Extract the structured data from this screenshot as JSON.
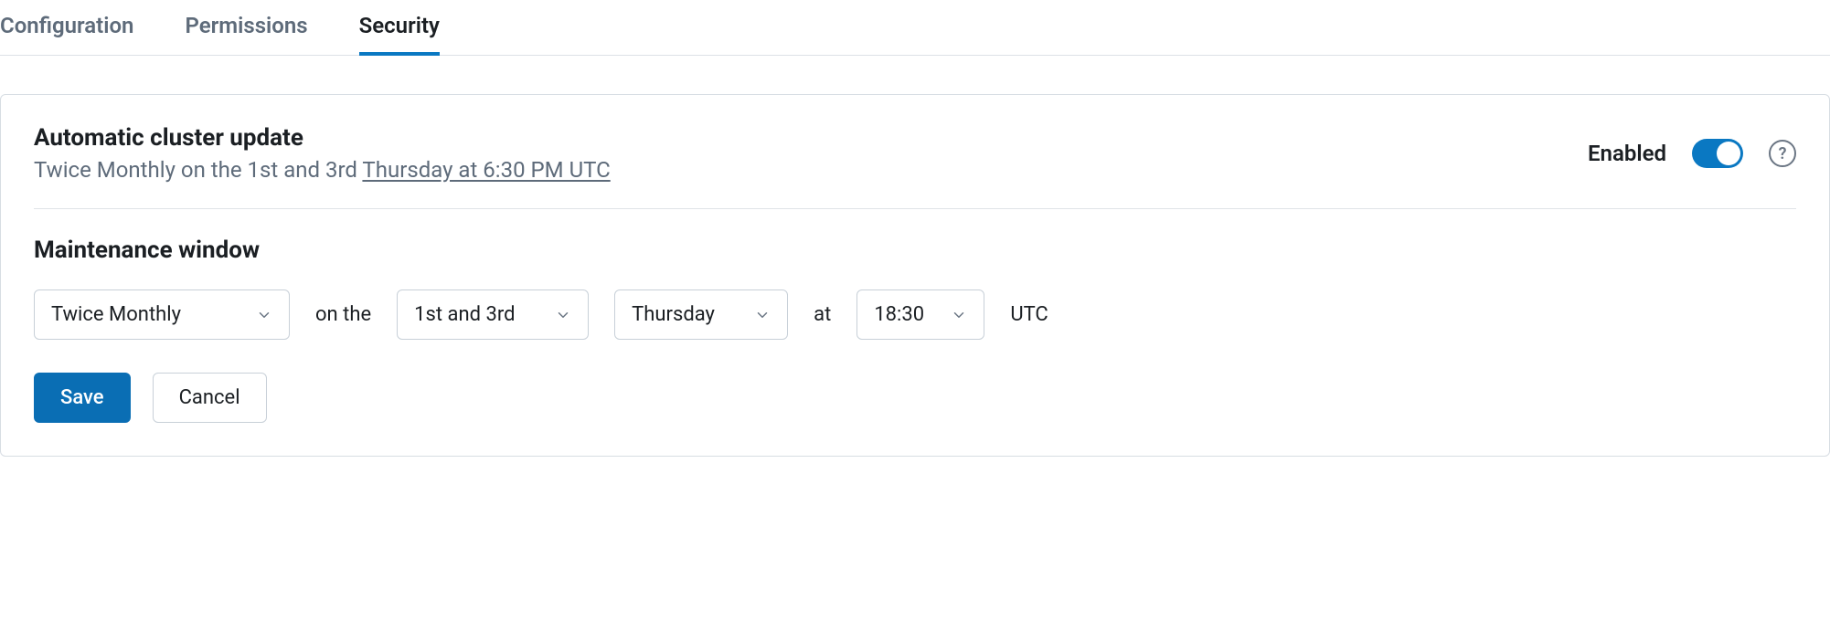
{
  "tabs": {
    "items": [
      {
        "label": "Configuration",
        "active": false
      },
      {
        "label": "Permissions",
        "active": false
      },
      {
        "label": "Security",
        "active": true
      }
    ]
  },
  "panel": {
    "title": "Automatic cluster update",
    "subtitle_prefix": "Twice Monthly on the 1st and 3rd ",
    "subtitle_link": "Thursday at 6:30 PM UTC",
    "toggle": {
      "label": "Enabled",
      "state": "on"
    },
    "help_glyph": "?"
  },
  "maintenance": {
    "title": "Maintenance window",
    "frequency": {
      "selected": "Twice Monthly"
    },
    "word_on_the": "on the",
    "ordinal": {
      "selected": "1st and 3rd"
    },
    "day": {
      "selected": "Thursday"
    },
    "word_at": "at",
    "time": {
      "selected": "18:30"
    },
    "tz": "UTC"
  },
  "actions": {
    "save": "Save",
    "cancel": "Cancel"
  }
}
